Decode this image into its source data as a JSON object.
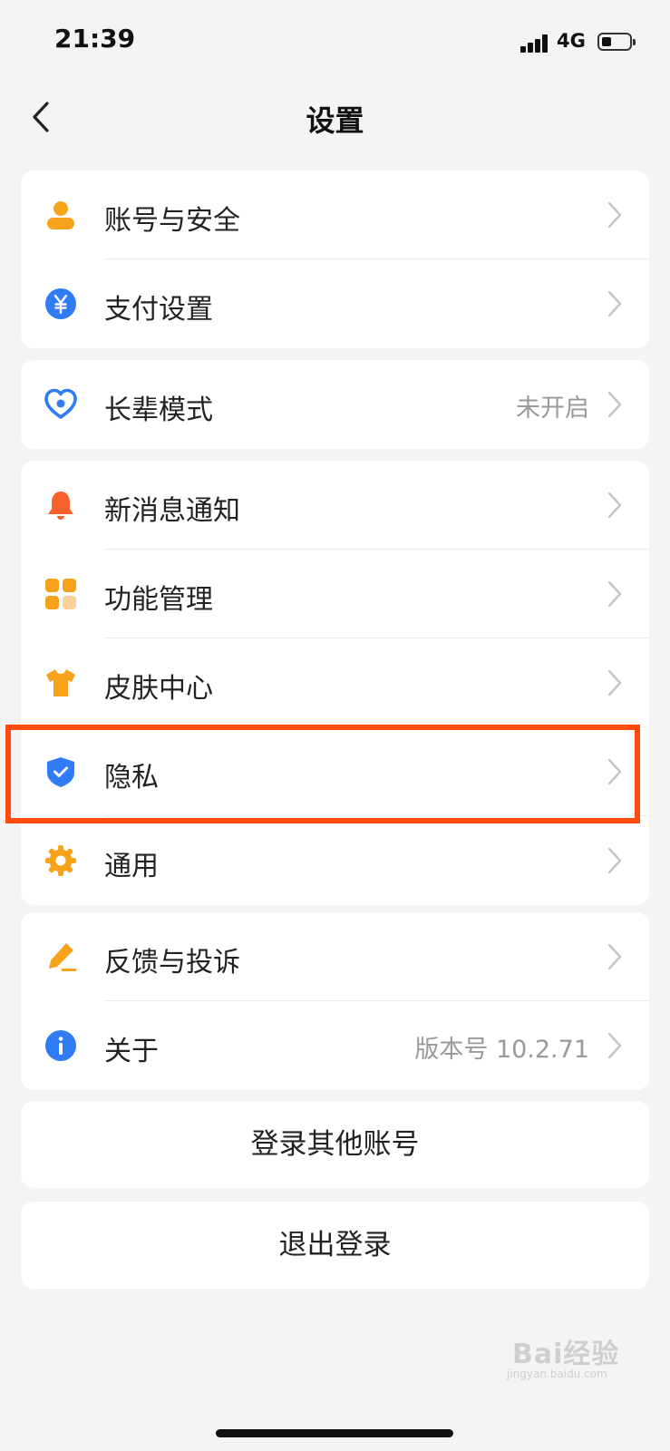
{
  "status": {
    "time": "21:39",
    "network": "4G"
  },
  "header": {
    "title": "设置"
  },
  "groups": [
    {
      "items": [
        {
          "label": "账号与安全",
          "icon": "user-icon"
        },
        {
          "label": "支付设置",
          "icon": "yuan-icon"
        }
      ]
    },
    {
      "items": [
        {
          "label": "长辈模式",
          "value": "未开启",
          "icon": "heart-icon"
        }
      ]
    },
    {
      "items": [
        {
          "label": "新消息通知",
          "icon": "bell-icon"
        },
        {
          "label": "功能管理",
          "icon": "grid-icon"
        },
        {
          "label": "皮肤中心",
          "icon": "tshirt-icon"
        },
        {
          "label": "隐私",
          "icon": "shield-check-icon",
          "highlighted": true
        },
        {
          "label": "通用",
          "icon": "gear-icon"
        }
      ]
    },
    {
      "items": [
        {
          "label": "反馈与投诉",
          "icon": "edit-icon"
        },
        {
          "label": "关于",
          "value": "版本号 10.2.71",
          "icon": "info-icon"
        }
      ]
    }
  ],
  "buttons": {
    "switch_account": "登录其他账号",
    "logout": "退出登录"
  },
  "watermark": {
    "brand": "Bai经验",
    "site": "jingyan.baidu.com"
  },
  "colors": {
    "orange": "#f7a21b",
    "blue": "#2f7cf6",
    "highlight": "#ff4a10",
    "background": "#f4f4f4"
  }
}
